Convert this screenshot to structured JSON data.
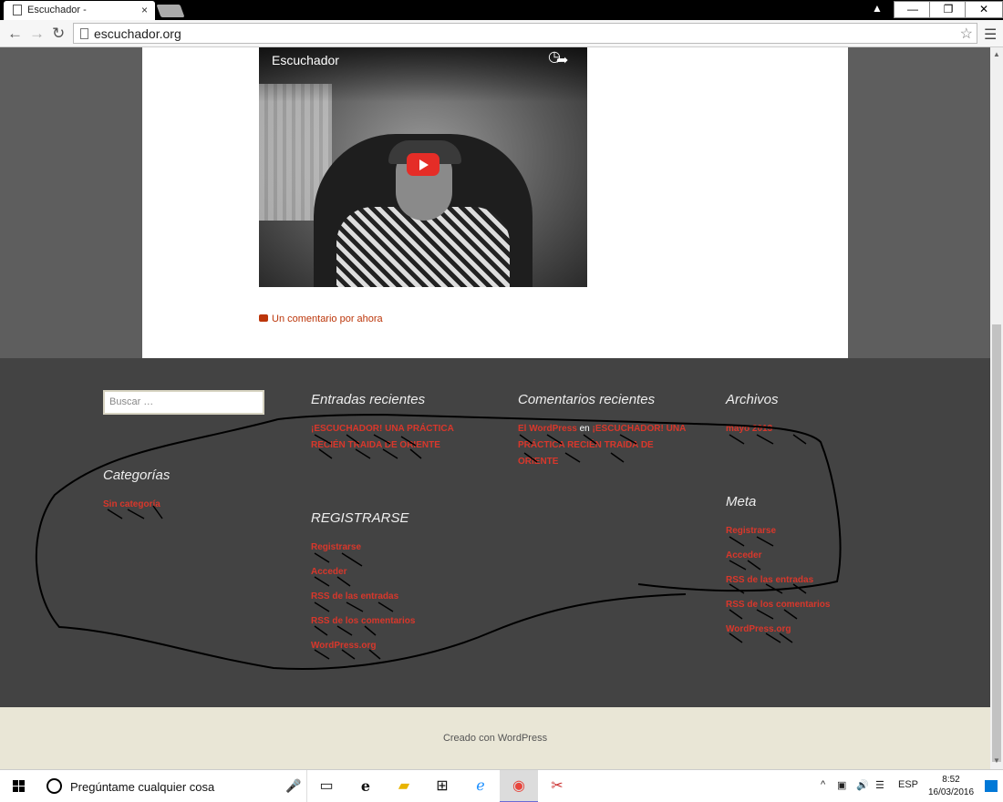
{
  "browser": {
    "tab_title": "Escuchador -",
    "tab_close": "×",
    "url": "escuchador.org",
    "window_buttons": [
      "—",
      "❐",
      "✕"
    ]
  },
  "page": {
    "video": {
      "title": "Escuchador"
    },
    "comment_link": "Un comentario por ahora",
    "search_placeholder": "Buscar …",
    "widgets": {
      "entradas": {
        "title": "Entradas recientes",
        "post": "¡ESCUCHADOR! UNA PRÁCTICA RECIÉN TRAIDA DE ORIENTE"
      },
      "comentarios": {
        "title": "Comentarios recientes",
        "author": "El WordPress",
        "en": "en",
        "post": "¡ESCUCHADOR! UNA PRÁCTICA RECIÉN TRAIDA DE ORIENTE"
      },
      "archivos": {
        "title": "Archivos",
        "item": "mayo 2013"
      },
      "categorias": {
        "title": "Categorías",
        "item": "Sin categoría"
      },
      "registrarse": {
        "title": "REGISTRARSE",
        "items": [
          "Registrarse",
          "Acceder",
          "RSS de las entradas",
          "RSS de los comentarios",
          "WordPress.org"
        ]
      },
      "meta": {
        "title": "Meta",
        "items": [
          "Registrarse",
          "Acceder",
          "RSS de las entradas",
          "RSS de los comentarios",
          "WordPress.org"
        ]
      }
    },
    "footer_credit": "Creado con WordPress"
  },
  "taskbar": {
    "search_placeholder": "Pregúntame cualquier cosa",
    "language": "ESP",
    "time": "8:52",
    "date": "16/03/2016"
  }
}
